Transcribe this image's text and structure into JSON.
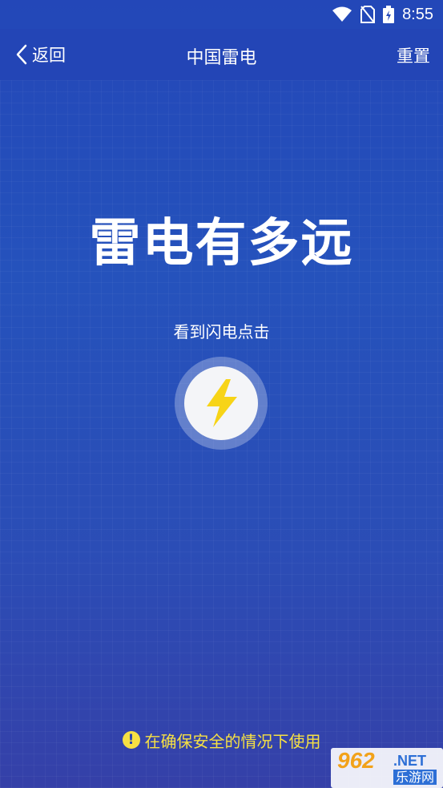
{
  "status_bar": {
    "time": "8:55",
    "icons": [
      "wifi-icon",
      "no-sim-icon",
      "battery-charging-icon"
    ]
  },
  "nav": {
    "back_label": "返回",
    "title": "中国雷电",
    "reset_label": "重置"
  },
  "main": {
    "headline": "雷电有多远",
    "hint": "看到闪电点击",
    "flash_button_icon": "lightning-bolt-icon"
  },
  "footer": {
    "warning_icon": "!",
    "warning": "在确保安全的情况下使用"
  },
  "watermark": {
    "number": "962",
    "suffix": ".NET",
    "site": "乐游网"
  },
  "colors": {
    "background": "#2552bc",
    "navbar": "#2345b6",
    "bolt": "#f7d417",
    "warning": "#f6e043"
  }
}
